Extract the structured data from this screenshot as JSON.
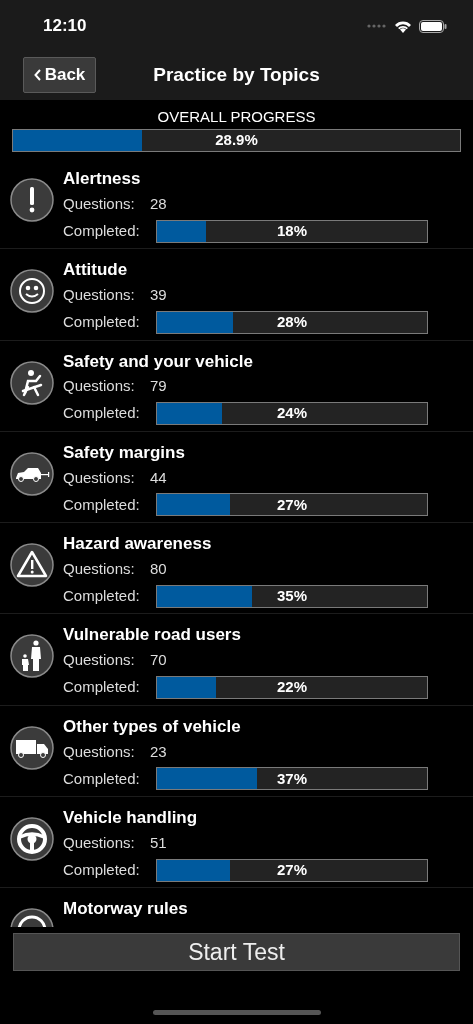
{
  "status_bar": {
    "time": "12:10"
  },
  "nav": {
    "back": "Back",
    "title": "Practice by Topics"
  },
  "overall": {
    "label": "OVERALL PROGRESS",
    "level": 0.289,
    "reading": "28.9%"
  },
  "topics": [
    {
      "title": "Alertness",
      "questions_label": "Questions:",
      "questions": "28",
      "completed_label": "Completed:",
      "level": 0.18,
      "reading": "18%"
    },
    {
      "title": "Attitude",
      "questions_label": "Questions:",
      "questions": "39",
      "completed_label": "Completed:",
      "level": 0.28,
      "reading": "28%"
    },
    {
      "title": "Safety and your vehicle",
      "questions_label": "Questions:",
      "questions": "79",
      "completed_label": "Completed:",
      "level": 0.24,
      "reading": "24%"
    },
    {
      "title": "Safety margins",
      "questions_label": "Questions:",
      "questions": "44",
      "completed_label": "Completed:",
      "level": 0.27,
      "reading": "27%"
    },
    {
      "title": "Hazard awareness",
      "questions_label": "Questions:",
      "questions": "80",
      "completed_label": "Completed:",
      "level": 0.35,
      "reading": "35%"
    },
    {
      "title": "Vulnerable road users",
      "questions_label": "Questions:",
      "questions": "70",
      "completed_label": "Completed:",
      "level": 0.22,
      "reading": "22%"
    },
    {
      "title": "Other types of vehicle",
      "questions_label": "Questions:",
      "questions": "23",
      "completed_label": "Completed:",
      "level": 0.37,
      "reading": "37%"
    },
    {
      "title": "Vehicle handling",
      "questions_label": "Questions:",
      "questions": "51",
      "completed_label": "Completed:",
      "level": 0.27,
      "reading": "27%"
    },
    {
      "title": "Motorway rules"
    }
  ],
  "start_button": "Start Test"
}
